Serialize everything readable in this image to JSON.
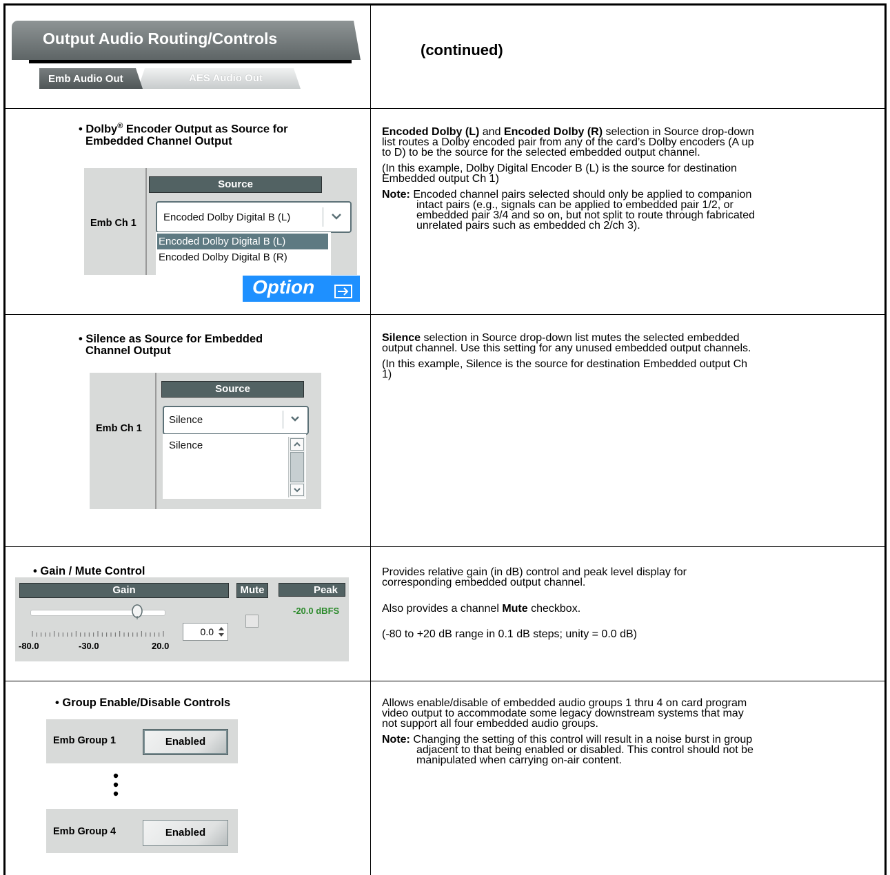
{
  "header": {
    "title": "Output Audio Routing/Controls",
    "tabs": [
      {
        "label": "Emb Audio Out"
      },
      {
        "label": "AES Audio Out"
      }
    ],
    "continued": "(continued)"
  },
  "rows": {
    "dolby": {
      "title_part1": "• Dolby",
      "title_sup": "®",
      "title_part2": " Encoder Output as Source for",
      "title_line2": "Embedded Channel Output",
      "widget": {
        "source_header": "Source",
        "channel_label": "Emb Ch 1",
        "selected_value": "Encoded Dolby Digital B (L)",
        "options": [
          "Encoded Dolby Digital B (L)",
          "Encoded Dolby Digital B (R)"
        ]
      },
      "option_badge": "Option",
      "desc_bold1": "Encoded Dolby (L)",
      "desc_and": " and ",
      "desc_bold2": "Encoded Dolby (R)",
      "desc_l1_rest": " selection in Source drop-down",
      "desc_l2": "list routes a Dolby encoded pair from any of the card’s Dolby encoders (A up",
      "desc_l3": "to D) to be the source for the selected embedded output channel.",
      "example_l1": "(In this example, Dolby Digital Encoder B (L) is the source for destination",
      "example_l2": "Embedded output Ch 1)",
      "note_label": "Note:",
      "note_l1": "Encoded channel pairs selected should only be applied to companion",
      "note_l2": "intact pairs (e.g., signals can be applied to embedded pair 1/2, or",
      "note_l3": "embedded pair 3/4 and so on, but not split to route through fabricated",
      "note_l4": "unrelated pairs such as embedded ch 2/ch 3)."
    },
    "silence": {
      "title_line1": "• Silence as Source for Embedded",
      "title_line2": "Channel Output",
      "widget": {
        "source_header": "Source",
        "channel_label": "Emb Ch 1",
        "selected_value": "Silence",
        "options": [
          "Silence"
        ]
      },
      "desc_bold": "Silence",
      "desc_l1_rest": " selection in Source drop-down list mutes the selected embedded",
      "desc_l2": "output channel. Use this setting for any unused embedded output channels.",
      "example_l1": "(In this example, Silence is the source for destination Embedded output Ch",
      "example_l2": "1)"
    },
    "gain": {
      "title": "• Gain / Mute Control",
      "widget": {
        "gain_header": "Gain",
        "mute_header": "Mute",
        "peak_header": "Peak",
        "peak_value": "-20.0 dBFS",
        "gain_value": "0.0",
        "slider_level": 0.8,
        "mute_checked": false,
        "scale_labels": [
          "-80.0",
          "-30.0",
          "20.0"
        ]
      },
      "desc_l1": "Provides relative gain (in dB) control and peak level display for",
      "desc_l2": "corresponding embedded output channel.",
      "desc_also": "Also provides a channel ",
      "desc_mute": "Mute",
      "desc_also_rest": " checkbox.",
      "desc_range": "(-80 to +20 dB range in 0.1 dB steps; unity = 0.0 dB)"
    },
    "group": {
      "title": "• Group Enable/Disable Controls",
      "widget": {
        "group1_label": "Emb Group 1",
        "group1_value": "Enabled",
        "group4_label": "Emb Group 4",
        "group4_value": "Enabled"
      },
      "desc_l1": "Allows enable/disable of embedded audio groups 1 thru 4 on card program",
      "desc_l2": "video output to accommodate some legacy downstream systems that may",
      "desc_l3": "not support all four embedded audio groups.",
      "note_label": "Note:",
      "note_l1": "Changing the setting of this control will result in a noise burst in group",
      "note_l2": "adjacent to that being enabled or disabled. This control should not be",
      "note_l3": "manipulated when carrying on-air content."
    }
  },
  "icons": {
    "dropdown": "chevron-down-icon",
    "option": "arrow-right-box-icon",
    "vertical_ellipsis": "vertical-ellipsis-icon"
  }
}
